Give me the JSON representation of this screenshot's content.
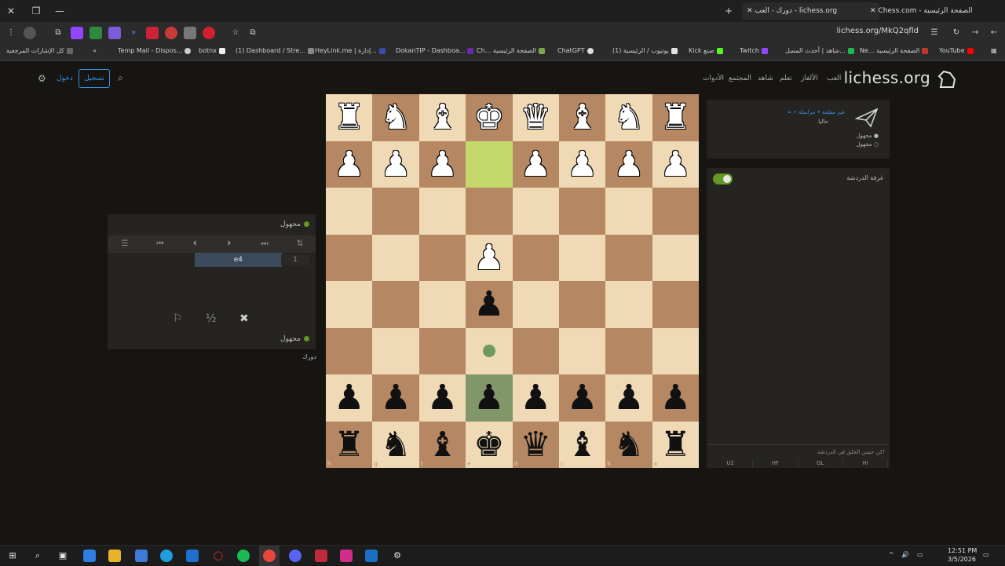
{
  "browser": {
    "tabs": [
      {
        "title": "دورك - العب - lichess.org",
        "active": true
      },
      {
        "title": "Chess.com - الصفحة الرئيسية",
        "active": false
      }
    ],
    "url": "lichess.org/MkQ2qfld",
    "bookmarks": [
      "كل الإشارات المرجعية",
      "Temp Mail - Dispos...",
      "botnx",
      "(1) Dashboard / Stre...",
      "HeyLink.me | إدارة...",
      "DokanTIP - Dashboa...",
      "Ch... الصفحة الرئيسية",
      "ChatGPT",
      "(1) يوتيوب / الرئيسية",
      "Kick صنع",
      "Twitch",
      "شاهد | أحدث المسل...",
      "Ne... الصفحة الرئيسية",
      "YouTube"
    ]
  },
  "header": {
    "logo": "lichess.org",
    "nav": [
      "العب",
      "الألغاز",
      "تعلم",
      "شاهد",
      "المجتمع",
      "الأدوات"
    ],
    "signin": "تسجيل",
    "login": "دخول"
  },
  "left_panel": {
    "top_player": "مجهول",
    "bottom_player": "مجهول",
    "move_number": "1",
    "white_move": "e4",
    "game_label": "دورك",
    "actions": {
      "draw": "½"
    }
  },
  "board": {
    "ranks": [
      "1",
      "2",
      "3",
      "4",
      "5",
      "6",
      "7",
      "8"
    ],
    "files": [
      "h",
      "g",
      "f",
      "e",
      "d",
      "c",
      "b",
      "a"
    ],
    "pieces": [
      [
        "wR",
        "wN",
        "wB",
        "wK",
        "wQ",
        "wB",
        "wN",
        "wR"
      ],
      [
        "wP",
        "wP",
        "wP",
        "",
        "wP",
        "wP",
        "wP",
        "wP"
      ],
      [
        "",
        "",
        "",
        "",
        "",
        "",
        "",
        ""
      ],
      [
        "",
        "",
        "",
        "wP",
        "",
        "",
        "",
        ""
      ],
      [
        "",
        "",
        "",
        "bP",
        "",
        "",
        "",
        ""
      ],
      [
        "",
        "",
        "",
        "",
        "",
        "",
        "",
        ""
      ],
      [
        "bP",
        "bP",
        "bP",
        "bP",
        "bP",
        "bP",
        "bP",
        "bP"
      ],
      [
        "bR",
        "bN",
        "bB",
        "bK",
        "bQ",
        "bB",
        "bN",
        "bR"
      ]
    ]
  },
  "right_panel": {
    "game_info": "∞ • غير مقيّمة • مراسلة",
    "now": "حاليا",
    "player_white": "مجهول",
    "player_black": "مجهول",
    "chat_title": "غرفة الدردشة",
    "chat_placeholder": "كن حسن الخلق في الدردشة!",
    "presets": [
      "HI",
      "GL",
      "HF",
      "U2"
    ]
  },
  "taskbar": {
    "time": "12:51 PM",
    "date": "3/5/2026"
  },
  "colors": {
    "light_square": "#f0d9b5",
    "dark_square": "#b58863",
    "accent": "#3692e7",
    "online": "#629924"
  }
}
